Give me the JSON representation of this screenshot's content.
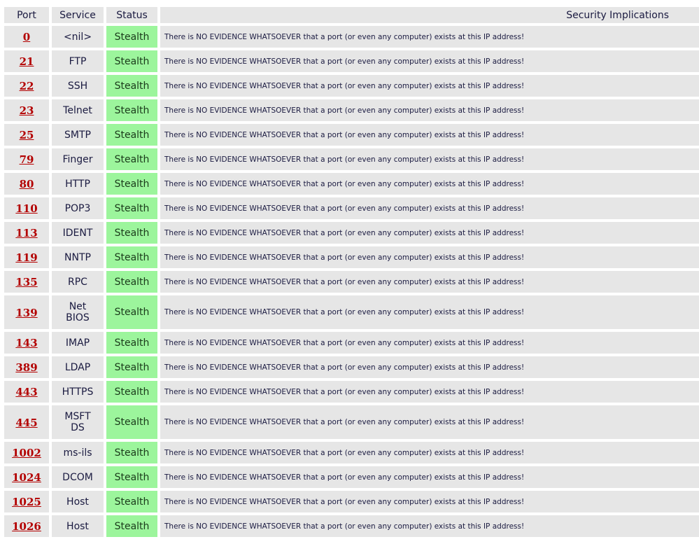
{
  "headers": {
    "port": "Port",
    "service": "Service",
    "status": "Status",
    "implications": "Security Implications"
  },
  "rows": [
    {
      "port": "0",
      "service": "<nil>",
      "status": "Stealth",
      "implication": "There is NO EVIDENCE WHATSOEVER that a port (or even any computer) exists at this IP address!"
    },
    {
      "port": "21",
      "service": "FTP",
      "status": "Stealth",
      "implication": "There is NO EVIDENCE WHATSOEVER that a port (or even any computer) exists at this IP address!"
    },
    {
      "port": "22",
      "service": "SSH",
      "status": "Stealth",
      "implication": "There is NO EVIDENCE WHATSOEVER that a port (or even any computer) exists at this IP address!"
    },
    {
      "port": "23",
      "service": "Telnet",
      "status": "Stealth",
      "implication": "There is NO EVIDENCE WHATSOEVER that a port (or even any computer) exists at this IP address!"
    },
    {
      "port": "25",
      "service": "SMTP",
      "status": "Stealth",
      "implication": "There is NO EVIDENCE WHATSOEVER that a port (or even any computer) exists at this IP address!"
    },
    {
      "port": "79",
      "service": "Finger",
      "status": "Stealth",
      "implication": "There is NO EVIDENCE WHATSOEVER that a port (or even any computer) exists at this IP address!"
    },
    {
      "port": "80",
      "service": "HTTP",
      "status": "Stealth",
      "implication": "There is NO EVIDENCE WHATSOEVER that a port (or even any computer) exists at this IP address!"
    },
    {
      "port": "110",
      "service": "POP3",
      "status": "Stealth",
      "implication": "There is NO EVIDENCE WHATSOEVER that a port (or even any computer) exists at this IP address!"
    },
    {
      "port": "113",
      "service": "IDENT",
      "status": "Stealth",
      "implication": "There is NO EVIDENCE WHATSOEVER that a port (or even any computer) exists at this IP address!"
    },
    {
      "port": "119",
      "service": "NNTP",
      "status": "Stealth",
      "implication": "There is NO EVIDENCE WHATSOEVER that a port (or even any computer) exists at this IP address!"
    },
    {
      "port": "135",
      "service": "RPC",
      "status": "Stealth",
      "implication": "There is NO EVIDENCE WHATSOEVER that a port (or even any computer) exists at this IP address!"
    },
    {
      "port": "139",
      "service_lines": [
        "Net",
        "BIOS"
      ],
      "status": "Stealth",
      "implication": "There is NO EVIDENCE WHATSOEVER that a port (or even any computer) exists at this IP address!"
    },
    {
      "port": "143",
      "service": "IMAP",
      "status": "Stealth",
      "implication": "There is NO EVIDENCE WHATSOEVER that a port (or even any computer) exists at this IP address!"
    },
    {
      "port": "389",
      "service": "LDAP",
      "status": "Stealth",
      "implication": "There is NO EVIDENCE WHATSOEVER that a port (or even any computer) exists at this IP address!"
    },
    {
      "port": "443",
      "service": "HTTPS",
      "status": "Stealth",
      "implication": "There is NO EVIDENCE WHATSOEVER that a port (or even any computer) exists at this IP address!"
    },
    {
      "port": "445",
      "service_lines": [
        "MSFT",
        "DS"
      ],
      "status": "Stealth",
      "implication": "There is NO EVIDENCE WHATSOEVER that a port (or even any computer) exists at this IP address!"
    },
    {
      "port": "1002",
      "service": "ms-ils",
      "status": "Stealth",
      "implication": "There is NO EVIDENCE WHATSOEVER that a port (or even any computer) exists at this IP address!"
    },
    {
      "port": "1024",
      "service": "DCOM",
      "status": "Stealth",
      "implication": "There is NO EVIDENCE WHATSOEVER that a port (or even any computer) exists at this IP address!"
    },
    {
      "port": "1025",
      "service": "Host",
      "status": "Stealth",
      "implication": "There is NO EVIDENCE WHATSOEVER that a port (or even any computer) exists at this IP address!"
    },
    {
      "port": "1026",
      "service": "Host",
      "status": "Stealth",
      "implication": "There is NO EVIDENCE WHATSOEVER that a port (or even any computer) exists at this IP address!"
    }
  ],
  "colors": {
    "header_bg": "#e6e6e6",
    "cell_bg": "#e6e6e6",
    "stealth_bg": "#9cf59c",
    "port_link": "#b30000",
    "text": "#1a1a40"
  }
}
